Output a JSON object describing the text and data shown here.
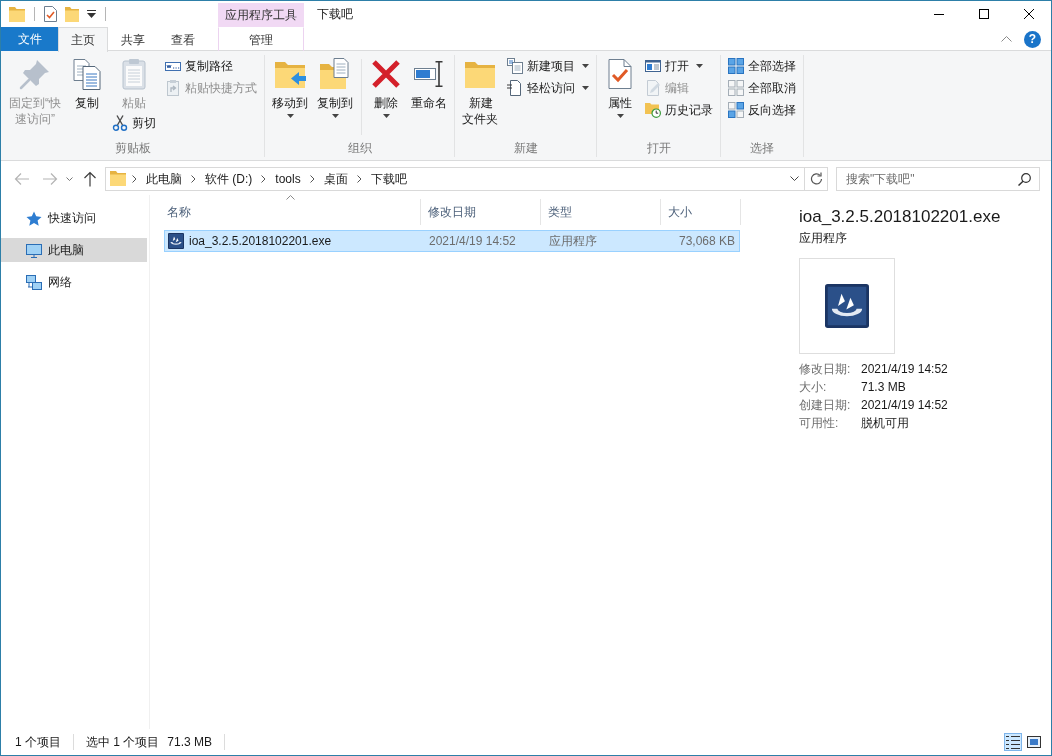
{
  "window": {
    "title": "下载吧",
    "context_tab_group": "应用程序工具"
  },
  "ribbon_tabs": [
    {
      "label": "文件",
      "kind": "file",
      "selected": false
    },
    {
      "label": "主页",
      "kind": "standard",
      "selected": true
    },
    {
      "label": "共享",
      "kind": "standard",
      "selected": false
    },
    {
      "label": "查看",
      "kind": "standard",
      "selected": false
    },
    {
      "label": "管理",
      "kind": "context",
      "selected": false
    }
  ],
  "help_button": "?",
  "ribbon_groups": [
    {
      "label": "剪贴板",
      "columns": [
        {
          "kind": "buttons",
          "items": [
            {
              "kind": "large",
              "label": "固定到“快速访问”",
              "disabled": true,
              "dropdown": false
            }
          ]
        },
        {
          "kind": "buttons",
          "items": [
            {
              "kind": "large",
              "label": "复制",
              "disabled": false,
              "dropdown": false
            }
          ]
        },
        {
          "kind": "buttons",
          "items": [
            {
              "kind": "large",
              "label": "粘贴",
              "disabled": true,
              "dropdown": false
            },
            {
              "kind": "small",
              "label": "剪切",
              "disabled": false,
              "dropdown": false
            }
          ]
        },
        {
          "kind": "buttons",
          "items": [
            {
              "kind": "small",
              "label": "复制路径",
              "disabled": false,
              "dropdown": false
            },
            {
              "kind": "small",
              "label": "粘贴快捷方式",
              "disabled": true,
              "dropdown": false
            }
          ]
        }
      ]
    },
    {
      "label": "组织",
      "columns": [
        {
          "kind": "buttons",
          "items": [
            {
              "kind": "large",
              "label": "移动到",
              "disabled": false,
              "dropdown": true
            }
          ]
        },
        {
          "kind": "buttons",
          "items": [
            {
              "kind": "large",
              "label": "复制到",
              "disabled": false,
              "dropdown": true
            }
          ]
        },
        {
          "kind": "separator"
        },
        {
          "kind": "buttons",
          "items": [
            {
              "kind": "large",
              "label": "删除",
              "disabled": false,
              "dropdown": true
            }
          ]
        },
        {
          "kind": "buttons",
          "items": [
            {
              "kind": "large",
              "label": "重命名",
              "disabled": false,
              "dropdown": false
            }
          ]
        }
      ]
    },
    {
      "label": "新建",
      "columns": [
        {
          "kind": "buttons",
          "items": [
            {
              "kind": "large",
              "label": "新建文件夹",
              "disabled": false,
              "dropdown": false
            }
          ]
        },
        {
          "kind": "buttons",
          "items": [
            {
              "kind": "small",
              "label": "新建项目",
              "disabled": false,
              "dropdown": true
            },
            {
              "kind": "small",
              "label": "轻松访问",
              "disabled": false,
              "dropdown": true
            }
          ]
        }
      ]
    },
    {
      "label": "打开",
      "columns": [
        {
          "kind": "buttons",
          "items": [
            {
              "kind": "large",
              "label": "属性",
              "disabled": false,
              "dropdown": true
            }
          ]
        },
        {
          "kind": "buttons",
          "items": [
            {
              "kind": "small",
              "label": "打开",
              "disabled": false,
              "dropdown": true
            },
            {
              "kind": "small",
              "label": "编辑",
              "disabled": true,
              "dropdown": false
            },
            {
              "kind": "small",
              "label": "历史记录",
              "disabled": false,
              "dropdown": false
            }
          ]
        }
      ]
    },
    {
      "label": "选择",
      "columns": [
        {
          "kind": "buttons",
          "items": [
            {
              "kind": "small",
              "label": "全部选择",
              "disabled": false,
              "dropdown": false
            },
            {
              "kind": "small",
              "label": "全部取消",
              "disabled": false,
              "dropdown": false
            },
            {
              "kind": "small",
              "label": "反向选择",
              "disabled": false,
              "dropdown": false
            }
          ]
        }
      ]
    }
  ],
  "nav_buttons": [
    {
      "disabled": true
    },
    {
      "disabled": true
    },
    {
      "disabled": false
    }
  ],
  "address_bar": {
    "path": [
      "此电脑",
      "软件 (D:)",
      "tools",
      "桌面",
      "下载吧"
    ]
  },
  "search": {
    "placeholder": "搜索\"下载吧\""
  },
  "navigation_pane": [
    {
      "label": "快速访问",
      "selected": false
    },
    {
      "label": "此电脑",
      "selected": true
    },
    {
      "label": "网络",
      "selected": false
    }
  ],
  "file_list": {
    "columns": [
      {
        "label": "名称",
        "sorted": true
      },
      {
        "label": "修改日期",
        "sorted": false
      },
      {
        "label": "类型",
        "sorted": false
      },
      {
        "label": "大小",
        "sorted": false
      }
    ],
    "rows": [
      {
        "name": "ioa_3.2.5.2018102201.exe",
        "modified": "2021/4/19 14:52",
        "type": "应用程序",
        "size": "73,068 KB",
        "selected": true
      }
    ]
  },
  "details_pane": {
    "title": "ioa_3.2.5.2018102201.exe",
    "type": "应用程序",
    "properties": [
      {
        "label": "修改日期:",
        "value": "2021/4/19 14:52"
      },
      {
        "label": "大小:",
        "value": "71.3 MB"
      },
      {
        "label": "创建日期:",
        "value": "2021/4/19 14:52"
      },
      {
        "label": "可用性:",
        "value": "脱机可用"
      }
    ]
  },
  "status_bar": {
    "item_count": "1 个项目",
    "selection": "选中 1 个项目",
    "selection_size": "71.3 MB",
    "view_buttons": [
      {
        "selected": true
      },
      {
        "selected": false
      }
    ]
  }
}
